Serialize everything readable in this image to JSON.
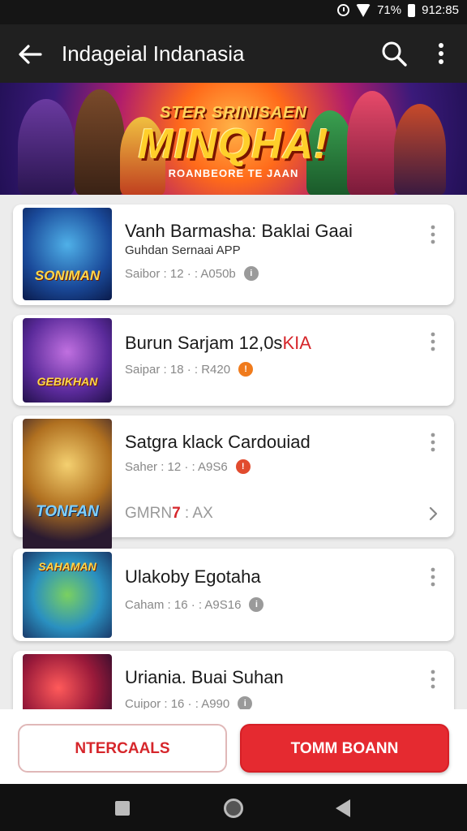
{
  "status_bar": {
    "battery": "71%",
    "time": "912:85"
  },
  "app_bar": {
    "title": "Indageial Indanasia",
    "icons": [
      "back-arrow-icon",
      "search-icon",
      "more-vert-icon"
    ]
  },
  "banner": {
    "small_text": "STER SRINISAEN",
    "big_text": "MINQHA!",
    "sub_text": "ROANBEORE TE JAAN"
  },
  "games": [
    {
      "thumb_label": "SONIMAN",
      "title": "Vanh Barmasha: Baklai Gaai",
      "subtitle": "Guhdan Sernaai APP",
      "meta": "Saibor : 12 · : A050b",
      "badge_icon": "info-icon",
      "badge_color": "#9a9a9a",
      "badge_glyph": "i"
    },
    {
      "thumb_label": "GEBIKHAN",
      "title": "Burun Sarjam 12,0s",
      "title_accent": "KIA",
      "meta": "Saipar : 18 · : R420",
      "badge_icon": "alert-icon",
      "badge_color": "#f07b1c",
      "badge_glyph": "!"
    },
    {
      "thumb_label": "TONFAN",
      "title": "Satgra klack Cardouiad",
      "meta": "Saher : 12 · : A9S6",
      "badge_icon": "alert-icon",
      "badge_color": "#e14b2e",
      "badge_glyph": "!",
      "extra_prefix": "GMRN",
      "extra_accent": "7",
      "extra_suffix": " : AX"
    },
    {
      "thumb_label": "SAHAMAN",
      "title": "Ulakoby Egotaha",
      "meta": "Caham : 16 · : A9S16",
      "badge_icon": "info-icon",
      "badge_color": "#9a9a9a",
      "badge_glyph": "i"
    },
    {
      "thumb_label": "",
      "title": "Uriania. Buai Suhan",
      "meta": "Cuipor : 16 · : A990",
      "badge_icon": "info-icon",
      "badge_color": "#9a9a9a",
      "badge_glyph": "i"
    }
  ],
  "actions": {
    "secondary": "NTERCAALS",
    "primary": "TOMM BOANN"
  },
  "colors": {
    "accent": "#e52a30",
    "app_bar": "#202020",
    "background": "#ececec"
  }
}
